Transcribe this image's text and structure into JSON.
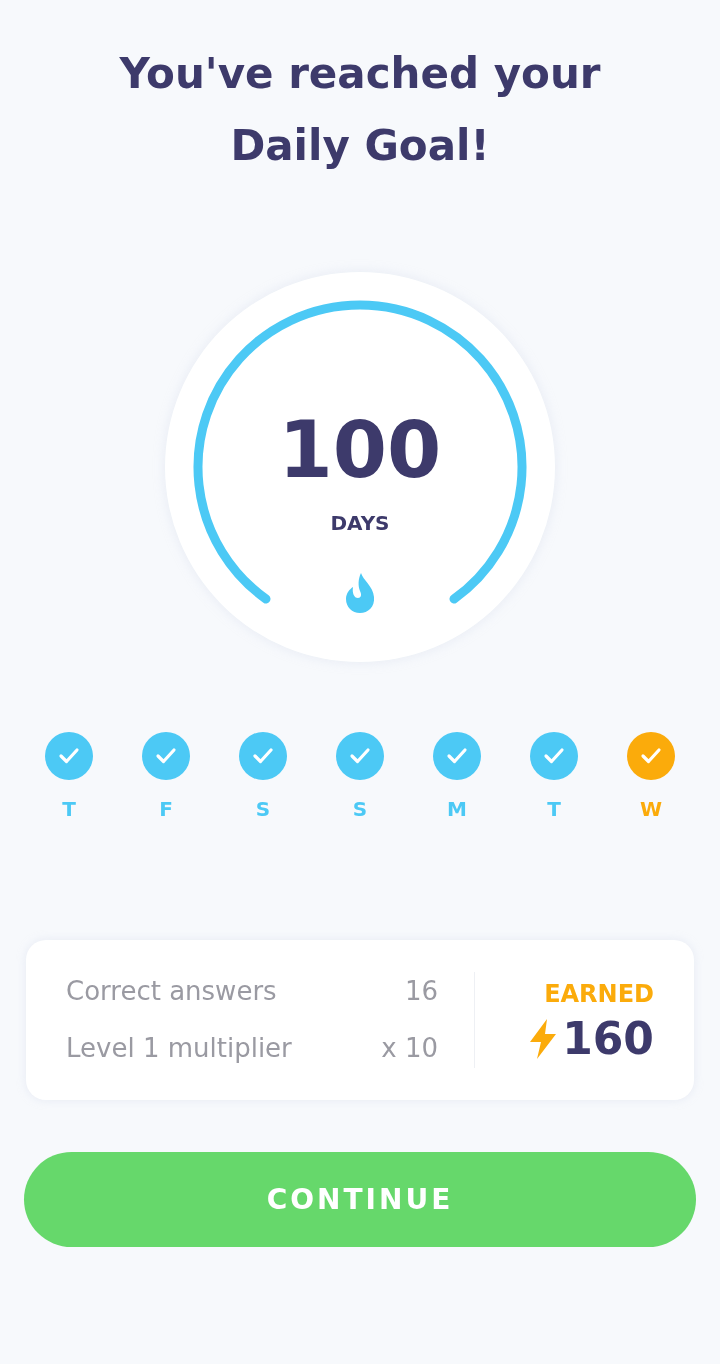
{
  "title": "You've reached your Daily Goal!",
  "streak": {
    "count": "100",
    "unit": "DAYS"
  },
  "days": [
    {
      "label": "T",
      "color": "#4cc9f5"
    },
    {
      "label": "F",
      "color": "#4cc9f5"
    },
    {
      "label": "S",
      "color": "#4cc9f5"
    },
    {
      "label": "S",
      "color": "#4cc9f5"
    },
    {
      "label": "M",
      "color": "#4cc9f5"
    },
    {
      "label": "T",
      "color": "#4cc9f5"
    },
    {
      "label": "W",
      "color": "#fbab0b"
    }
  ],
  "summary": {
    "rows": [
      {
        "label": "Correct answers",
        "value": "16"
      },
      {
        "label": "Level 1 multiplier",
        "value": "x 10"
      }
    ],
    "earned_label": "EARNED",
    "earned_value": "160"
  },
  "button": "CONTINUE"
}
